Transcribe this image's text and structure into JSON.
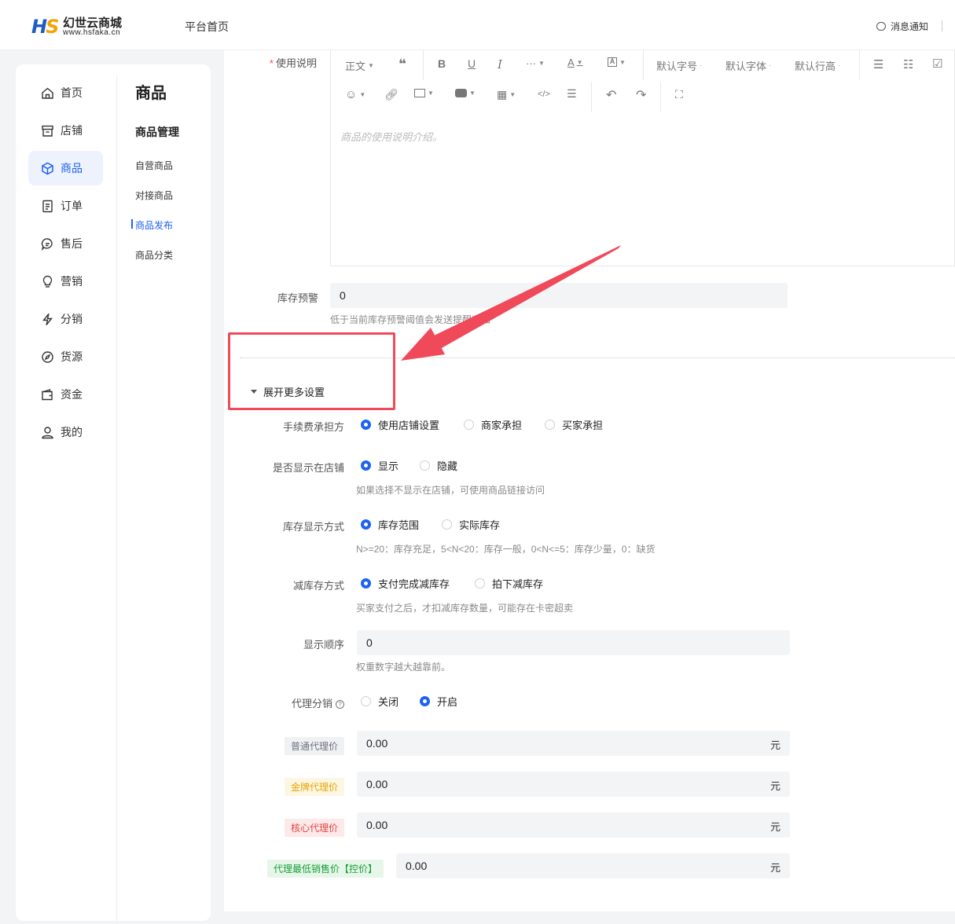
{
  "header": {
    "logo_mark_a": "H",
    "logo_mark_b": "S",
    "logo_name": "幻世云商城",
    "logo_domain": "www.hsfaka.cn",
    "home_link": "平台首页",
    "notify_label": "消息通知"
  },
  "sidebar": {
    "items": [
      {
        "label": "首页",
        "icon": "home-icon"
      },
      {
        "label": "店铺",
        "icon": "store-icon"
      },
      {
        "label": "商品",
        "icon": "cube-icon"
      },
      {
        "label": "订单",
        "icon": "order-icon"
      },
      {
        "label": "售后",
        "icon": "chat-icon"
      },
      {
        "label": "营销",
        "icon": "bulb-icon"
      },
      {
        "label": "分销",
        "icon": "bolt-icon"
      },
      {
        "label": "货源",
        "icon": "compass-icon"
      },
      {
        "label": "资金",
        "icon": "wallet-icon"
      },
      {
        "label": "我的",
        "icon": "user-icon"
      }
    ],
    "active_index": 2
  },
  "submenu": {
    "title": "商品",
    "group": "商品管理",
    "items": [
      "自营商品",
      "对接商品",
      "商品发布",
      "商品分类"
    ],
    "active_index": 2
  },
  "form": {
    "usage_label": "使用说明",
    "editor_toolbar": {
      "paragraph": "正文",
      "font_size": "默认字号",
      "font_family": "默认字体",
      "line_height": "默认行高"
    },
    "editor_placeholder": "商品的使用说明介绍。",
    "stock_warning_label": "库存预警",
    "stock_warning_value": "0",
    "stock_warning_hint": "低于当前库存预警阈值会发送提醒通知",
    "expand_label": "展开更多设置",
    "fee_label": "手续费承担方",
    "fee_options": [
      "使用店铺设置",
      "商家承担",
      "买家承担"
    ],
    "fee_selected": 0,
    "show_store_label": "是否显示在店铺",
    "show_store_options": [
      "显示",
      "隐藏"
    ],
    "show_store_selected": 0,
    "show_store_hint": "如果选择不显示在店铺，可使用商品链接访问",
    "stock_display_label": "库存显示方式",
    "stock_display_options": [
      "库存范围",
      "实际库存"
    ],
    "stock_display_selected": 0,
    "stock_display_hint": "N>=20：库存充足，5<N<20：库存一般，0<N<=5：库存少量，0：缺货",
    "deduct_label": "减库存方式",
    "deduct_options": [
      "支付完成减库存",
      "拍下减库存"
    ],
    "deduct_selected": 0,
    "deduct_hint": "买家支付之后，才扣减库存数量，可能存在卡密超卖",
    "order_label": "显示顺序",
    "order_value": "0",
    "order_hint": "权重数字越大越靠前。",
    "agent_label": "代理分销",
    "agent_help": "?",
    "agent_options": [
      "关闭",
      "开启"
    ],
    "agent_selected": 1,
    "prices": [
      {
        "label": "普通代理价",
        "value": "0.00",
        "unit": "元",
        "tag_color": "#6b7280",
        "tag_bg": "#f0f1f3"
      },
      {
        "label": "金牌代理价",
        "value": "0.00",
        "unit": "元",
        "tag_color": "#e8a500",
        "tag_bg": "#fdf6e3"
      },
      {
        "label": "核心代理价",
        "value": "0.00",
        "unit": "元",
        "tag_color": "#e04646",
        "tag_bg": "#fde9e9"
      },
      {
        "label": "代理最低销售价【控价】",
        "value": "0.00",
        "unit": "元",
        "tag_color": "#1a9e3a",
        "tag_bg": "#e6f7ea"
      }
    ]
  },
  "colors": {
    "accent": "#1e62f0",
    "highlight": "#f0495a"
  }
}
